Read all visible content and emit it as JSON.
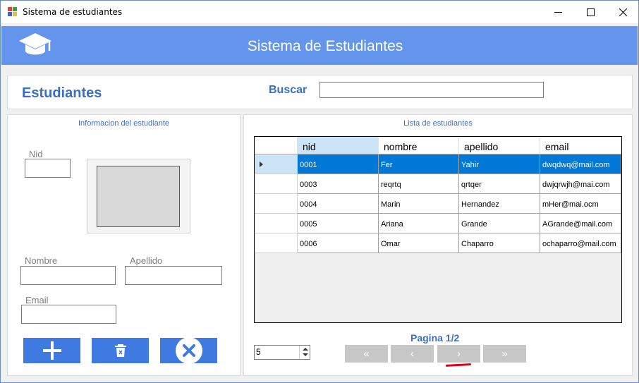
{
  "window": {
    "title": "Sistema de estudiantes"
  },
  "header": {
    "title": "Sistema de Estudiantes",
    "icon": "graduation-cap-icon",
    "color": "#6495ed"
  },
  "top": {
    "heading": "Estudiantes",
    "search_label": "Buscar",
    "search_value": ""
  },
  "form": {
    "group_title": "Informacion del estudiante",
    "nid_label": "Nid",
    "nid_value": "",
    "nombre_label": "Nombre",
    "nombre_value": "",
    "apellido_label": "Apellido",
    "apellido_value": "",
    "email_label": "Email",
    "email_value": "",
    "buttons": {
      "add_icon": "plus-icon",
      "delete_icon": "trash-icon",
      "cancel_icon": "close-circle-icon"
    },
    "accent": "#3f7ae0"
  },
  "list": {
    "group_title": "Lista de estudiantes",
    "columns": [
      "nid",
      "nombre",
      "apellido",
      "email"
    ],
    "rows": [
      {
        "nid": "0001",
        "nombre": "Fer",
        "apellido": "Yahir",
        "email": "dwqdwq@mail.com"
      },
      {
        "nid": "0003",
        "nombre": "reqrtq",
        "apellido": "qrtqer",
        "email": "dwjqrwjh@mai.com"
      },
      {
        "nid": "0004",
        "nombre": "Marin",
        "apellido": "Hernandez",
        "email": "mHer@mai.ocm"
      },
      {
        "nid": "0005",
        "nombre": "Ariana",
        "apellido": "Grande",
        "email": "AGrande@mail.com"
      },
      {
        "nid": "0006",
        "nombre": "Omar",
        "apellido": "Chaparro",
        "email": "ochaparro@mail.com"
      }
    ],
    "selected_row": 0,
    "selection_color": "#0078d7"
  },
  "pagination": {
    "label": "Pagina 1/2",
    "page_size": "5",
    "first": "«",
    "prev": "‹",
    "next": "›",
    "last": "»"
  }
}
